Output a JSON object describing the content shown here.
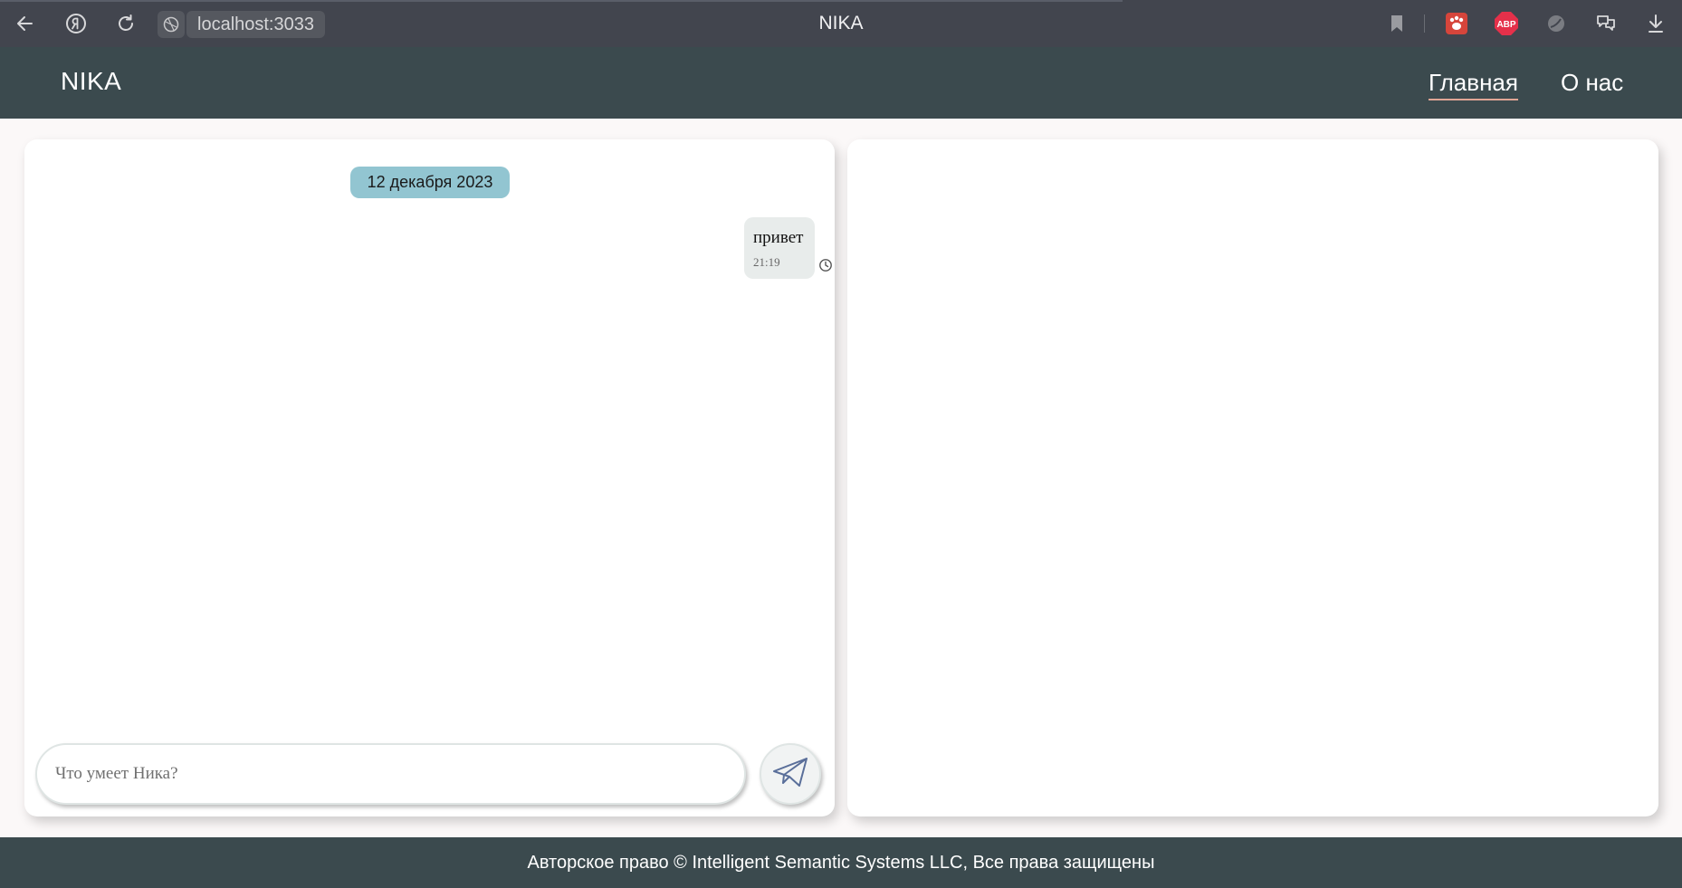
{
  "browser": {
    "url": "localhost:3033",
    "tab_title": "NIKA",
    "icons": [
      "back-icon",
      "yandex-icon",
      "reload-icon",
      "site-info-icon",
      "bookmark-icon",
      "extension-paw-icon",
      "adblock-icon",
      "extension-leaf-icon",
      "chat-bubbles-icon",
      "download-icon"
    ],
    "adblock_label": "ABP"
  },
  "header": {
    "logo": "NIKA",
    "nav": [
      {
        "label": "Главная",
        "active": true
      },
      {
        "label": "О нас",
        "active": false
      }
    ]
  },
  "chat": {
    "date_label": "12 декабря 2023",
    "messages": [
      {
        "text": "привет",
        "time": "21:19",
        "status_icon": "clock-icon"
      }
    ],
    "input": {
      "placeholder": "Что умеет Ника?",
      "value": ""
    },
    "send_icon": "paper-plane-icon"
  },
  "footer": {
    "text": "Авторское право © Intelligent Semantic Systems LLC, Все права защищены"
  },
  "colors": {
    "header_bg": "#3b4a4e",
    "browser_bg": "#42454e",
    "date_pill": "#92c5d1",
    "message_bg": "#e8eceb",
    "active_underline": "#e0a595",
    "adblock_red": "#e5304a"
  }
}
